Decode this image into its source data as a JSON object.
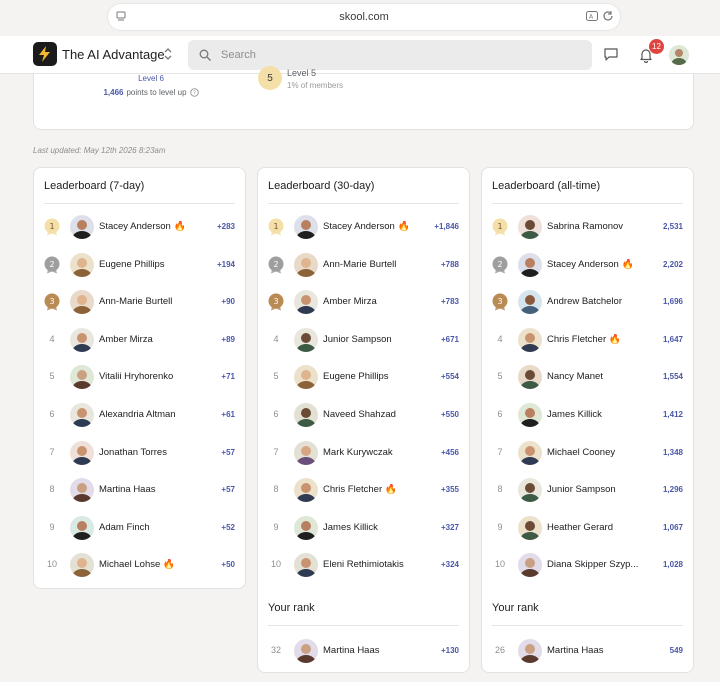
{
  "browser": {
    "url": "skool.com"
  },
  "header": {
    "group_name": "The AI Advantage",
    "search_placeholder": "Search",
    "notification_count": "12"
  },
  "level_card": {
    "current_level": "Level 6",
    "points_to_level_up": "1,466",
    "points_suffix": "points to level up",
    "next_badge": "5",
    "next_name": "Level 5",
    "next_percent": "1% of members"
  },
  "last_updated": "Last updated: May 12th 2026 8:23am",
  "colors": {
    "accent": "#4a57a8",
    "gold": "#f5dfa8",
    "silver": "#9e9e9e",
    "bronze": "#b98a52",
    "notification": "#e0443f"
  },
  "leaderboards": [
    {
      "title": "Leaderboard (7-day)",
      "rows": [
        {
          "rank": "1",
          "name": "Stacey Anderson",
          "fire": true,
          "points": "+283"
        },
        {
          "rank": "2",
          "name": "Eugene Phillips",
          "fire": false,
          "points": "+194"
        },
        {
          "rank": "3",
          "name": "Ann-Marie Burtell",
          "fire": false,
          "points": "+90"
        },
        {
          "rank": "4",
          "name": "Amber Mirza",
          "fire": false,
          "points": "+89"
        },
        {
          "rank": "5",
          "name": "Vitalii Hryhorenko",
          "fire": false,
          "points": "+71"
        },
        {
          "rank": "6",
          "name": "Alexandria Altman",
          "fire": false,
          "points": "+61"
        },
        {
          "rank": "7",
          "name": "Jonathan Torres",
          "fire": false,
          "points": "+57"
        },
        {
          "rank": "8",
          "name": "Martina Haas",
          "fire": false,
          "points": "+57"
        },
        {
          "rank": "9",
          "name": "Adam Finch",
          "fire": false,
          "points": "+52"
        },
        {
          "rank": "10",
          "name": "Michael Lohse",
          "fire": true,
          "points": "+50"
        }
      ]
    },
    {
      "title": "Leaderboard (30-day)",
      "rows": [
        {
          "rank": "1",
          "name": "Stacey Anderson",
          "fire": true,
          "points": "+1,846"
        },
        {
          "rank": "2",
          "name": "Ann-Marie Burtell",
          "fire": false,
          "points": "+788"
        },
        {
          "rank": "3",
          "name": "Amber Mirza",
          "fire": false,
          "points": "+783"
        },
        {
          "rank": "4",
          "name": "Junior Sampson",
          "fire": false,
          "points": "+671"
        },
        {
          "rank": "5",
          "name": "Eugene Phillips",
          "fire": false,
          "points": "+554"
        },
        {
          "rank": "6",
          "name": "Naveed Shahzad",
          "fire": false,
          "points": "+550"
        },
        {
          "rank": "7",
          "name": "Mark Kurywczak",
          "fire": false,
          "points": "+456"
        },
        {
          "rank": "8",
          "name": "Chris Fletcher",
          "fire": true,
          "points": "+355"
        },
        {
          "rank": "9",
          "name": "James Killick",
          "fire": false,
          "points": "+327"
        },
        {
          "rank": "10",
          "name": "Eleni Rethimiotakis",
          "fire": false,
          "points": "+324"
        }
      ],
      "your_rank": {
        "title": "Your rank",
        "rank": "32",
        "name": "Martina Haas",
        "points": "+130"
      }
    },
    {
      "title": "Leaderboard (all-time)",
      "rows": [
        {
          "rank": "1",
          "name": "Sabrina Ramonov",
          "fire": false,
          "points": "2,531"
        },
        {
          "rank": "2",
          "name": "Stacey Anderson",
          "fire": true,
          "points": "2,202"
        },
        {
          "rank": "3",
          "name": "Andrew Batchelor",
          "fire": false,
          "points": "1,696"
        },
        {
          "rank": "4",
          "name": "Chris Fletcher",
          "fire": true,
          "points": "1,647"
        },
        {
          "rank": "5",
          "name": "Nancy Manet",
          "fire": false,
          "points": "1,554"
        },
        {
          "rank": "6",
          "name": "James Killick",
          "fire": false,
          "points": "1,412"
        },
        {
          "rank": "7",
          "name": "Michael Cooney",
          "fire": false,
          "points": "1,348"
        },
        {
          "rank": "8",
          "name": "Junior Sampson",
          "fire": false,
          "points": "1,296"
        },
        {
          "rank": "9",
          "name": "Heather Gerard",
          "fire": false,
          "points": "1,067"
        },
        {
          "rank": "10",
          "name": "Diana Skipper Szyp...",
          "fire": false,
          "points": "1,028"
        }
      ],
      "your_rank": {
        "title": "Your rank",
        "rank": "26",
        "name": "Martina Haas",
        "points": "549"
      }
    }
  ]
}
